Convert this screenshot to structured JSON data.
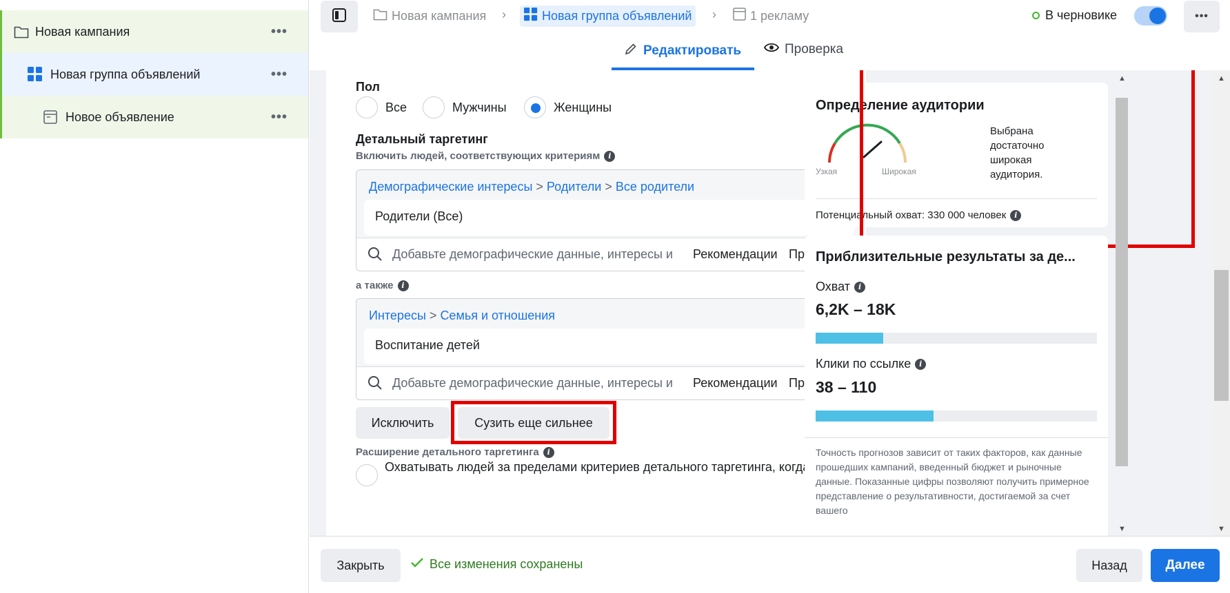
{
  "sidebar": {
    "items": [
      {
        "label": "Новая кампания",
        "icon": "folder-icon"
      },
      {
        "label": "Новая группа объявлений",
        "icon": "grid-icon"
      },
      {
        "label": "Новое объявление",
        "icon": "ad-icon"
      }
    ],
    "more": "•••"
  },
  "header": {
    "breadcrumbs": [
      "Новая кампания",
      "Новая группа объявлений",
      "1 рекламу"
    ],
    "status": "В черновике",
    "more": "•••",
    "toggle_on": true
  },
  "tabs": [
    {
      "label": "Редактировать",
      "icon": "pencil-icon",
      "active": true
    },
    {
      "label": "Проверка",
      "icon": "eye-icon",
      "active": false
    }
  ],
  "form": {
    "gender": {
      "title": "Пол",
      "options": [
        "Все",
        "Мужчины",
        "Женщины"
      ],
      "selected": "Женщины"
    },
    "detailed": {
      "title": "Детальный таргетинг",
      "include_label": "Включить людей, соответствующих критериям",
      "box1": {
        "path": [
          "Демографические интересы",
          "Родители",
          "Все родители"
        ],
        "chip": "Родители (Все)"
      },
      "and_also": "а также",
      "box2": {
        "path": [
          "Интересы",
          "Семья и отношения"
        ],
        "chip": "Воспитание детей"
      },
      "search_placeholder": "Добавьте демографические данные, интересы и",
      "recommendations": "Рекомендации",
      "browse": "Просмотр",
      "separator": ">"
    },
    "exclude_btn": "Исключить",
    "narrow_btn": "Сузить еще сильнее",
    "expansion_title": "Расширение детального таргетинга",
    "expansion_text": "Охватывать людей за пределами критериев детального таргетинга, когда это"
  },
  "audience": {
    "title": "Определение аудитории",
    "narrow": "Узкая",
    "wide": "Широкая",
    "description": [
      "Выбрана",
      "достаточно",
      "широкая",
      "аудитория."
    ],
    "potential_reach": "Потенциальный охват: 330 000 человек"
  },
  "estimates": {
    "title": "Приблизительные результаты за де...",
    "reach_label": "Охват",
    "reach_value": "6,2K – 18K",
    "reach_fill": 0.24,
    "clicks_label": "Клики по ссылке",
    "clicks_value": "38 – 110",
    "clicks_fill": 0.42,
    "disclaimer": "Точность прогнозов зависит от таких факторов, как данные прошедших кампаний, введенный бюджет и рыночные данные. Показанные цифры позволяют получить примерное представление о результативности, достигаемой за счет вашего",
    "bar_color": "#4ec0e6"
  },
  "footer": {
    "close": "Закрыть",
    "saved": "Все изменения сохранены",
    "back": "Назад",
    "next": "Далее"
  }
}
